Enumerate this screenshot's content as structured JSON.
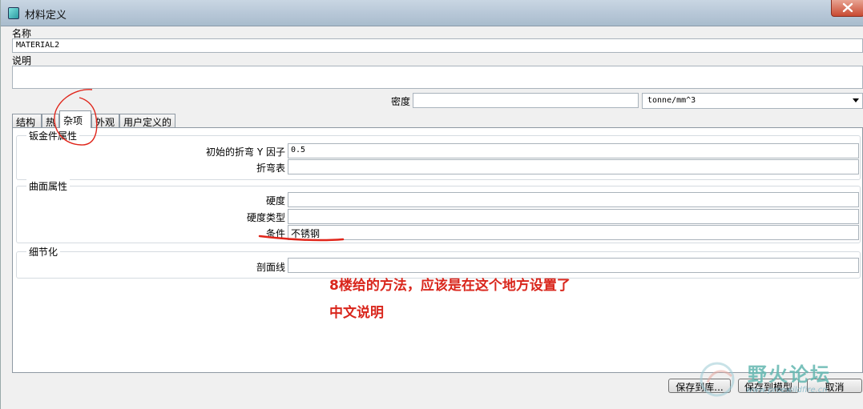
{
  "window": {
    "title": "材料定义"
  },
  "header": {
    "name_label": "名称",
    "name_value": "MATERIAL2",
    "desc_label": "说明",
    "desc_value": "",
    "density_label": "密度",
    "density_value": "",
    "density_unit": "tonne/mm^3"
  },
  "tabs": [
    {
      "label": "结构"
    },
    {
      "label": "热"
    },
    {
      "label": "杂项"
    },
    {
      "label": "外观"
    },
    {
      "label": "用户定义的"
    }
  ],
  "active_tab": "杂项",
  "sheetmetal": {
    "title": "钣金件属性",
    "bend_label": "初始的折弯 Y 因子",
    "bend_value": "0.5",
    "table_label": "折弯表",
    "table_value": ""
  },
  "surface": {
    "title": "曲面属性",
    "hardness_label": "硬度",
    "hardness_value": "",
    "hardness_type_label": "硬度类型",
    "hardness_type_value": "",
    "condition_label": "条件",
    "condition_value": "不锈钢"
  },
  "detail": {
    "title": "细节化",
    "hatch_label": "剖面线",
    "hatch_value": ""
  },
  "annotation": {
    "line1": "8楼给的方法，应该是在这个地方设置了",
    "line2": "中文说明",
    "color": "#d9261c"
  },
  "buttons": {
    "save_lib": "保存到库...",
    "save_model": "保存到模型",
    "cancel": "取消"
  },
  "watermark": {
    "main": "野火论坛",
    "sub": "www.proewildfire.cn"
  }
}
